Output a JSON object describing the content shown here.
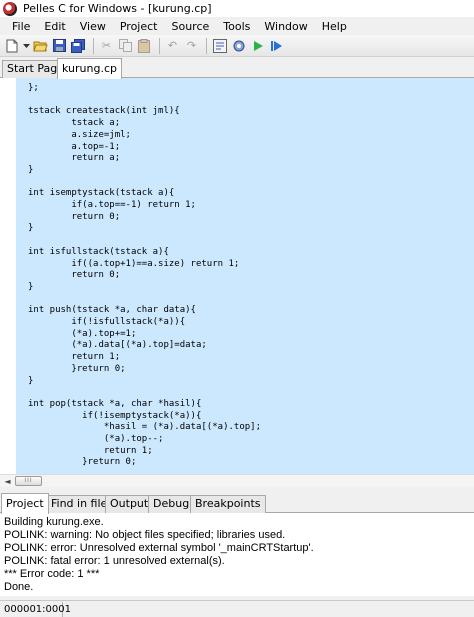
{
  "window": {
    "title": "Pelles C for Windows - [kurung.cp]"
  },
  "menu": [
    "File",
    "Edit",
    "View",
    "Project",
    "Source",
    "Tools",
    "Window",
    "Help"
  ],
  "toolbar": {
    "icons": [
      "new-file-icon",
      "dropdown-arrow-icon",
      "open-folder-icon",
      "save-icon",
      "save-all-icon",
      "cut-icon",
      "copy-icon",
      "paste-icon",
      "undo-icon",
      "redo-icon",
      "compile-icon",
      "build-icon",
      "execute-icon",
      "debug-icon"
    ]
  },
  "editor_tabs": [
    "Start Page",
    "kurung.cp"
  ],
  "code_lines": [
    "};",
    "",
    "tstack createstack(int jml){",
    "        tstack a;",
    "        a.size=jml;",
    "        a.top=-1;",
    "        return a;",
    "}",
    "",
    "int isemptystack(tstack a){",
    "        if(a.top==-1) return 1;",
    "        return 0;",
    "}",
    "",
    "int isfullstack(tstack a){",
    "        if((a.top+1)==a.size) return 1;",
    "        return 0;",
    "}",
    "",
    "int push(tstack *a, char data){",
    "        if(!isfullstack(*a)){",
    "        (*a).top+=1;",
    "        (*a).data[(*a).top]=data;",
    "        return 1;",
    "        }return 0;",
    "}",
    "",
    "int pop(tstack *a, char *hasil){",
    "          if(!isemptystack(*a)){",
    "              *hasil = (*a).data[(*a).top];",
    "              (*a).top--;",
    "              return 1;",
    "          }return 0;"
  ],
  "hscroll": {
    "left_arrow": "◄",
    "thumb_grip": "III"
  },
  "bottom_tabs": [
    "Project",
    "Find in files",
    "Output",
    "Debug",
    "Breakpoints"
  ],
  "output_lines": [
    "Building kurung.exe.",
    "POLINK: warning: No object files specified; libraries used.",
    "POLINK: error: Unresolved external symbol '_mainCRTStartup'.",
    "POLINK: fatal error: 1 unresolved external(s).",
    "*** Error code: 1 ***",
    "Done."
  ],
  "status": {
    "position": "000001:0001"
  },
  "colors": {
    "code_selection_bg": "#cce8ff",
    "window_bg": "#f0f0f0"
  }
}
